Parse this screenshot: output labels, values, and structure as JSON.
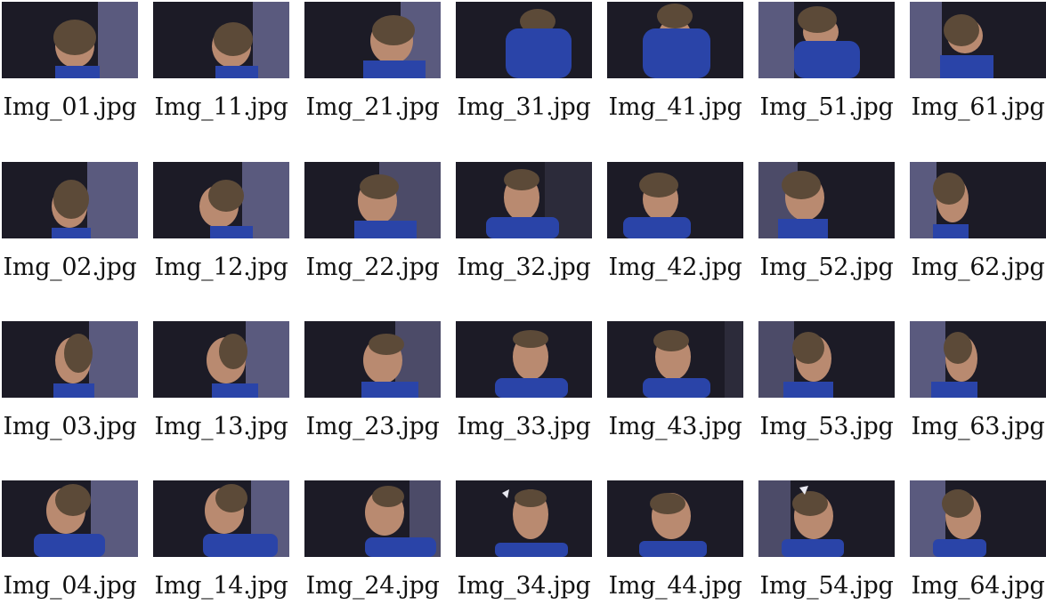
{
  "gallery": {
    "columns": 7,
    "rows": 4,
    "items": [
      {
        "filename": "Img_01.jpg"
      },
      {
        "filename": "Img_11.jpg"
      },
      {
        "filename": "Img_21.jpg"
      },
      {
        "filename": "Img_31.jpg"
      },
      {
        "filename": "Img_41.jpg"
      },
      {
        "filename": "Img_51.jpg"
      },
      {
        "filename": "Img_61.jpg"
      },
      {
        "filename": "Img_02.jpg"
      },
      {
        "filename": "Img_12.jpg"
      },
      {
        "filename": "Img_22.jpg"
      },
      {
        "filename": "Img_32.jpg"
      },
      {
        "filename": "Img_42.jpg"
      },
      {
        "filename": "Img_52.jpg"
      },
      {
        "filename": "Img_62.jpg"
      },
      {
        "filename": "Img_03.jpg"
      },
      {
        "filename": "Img_13.jpg"
      },
      {
        "filename": "Img_23.jpg"
      },
      {
        "filename": "Img_33.jpg"
      },
      {
        "filename": "Img_43.jpg"
      },
      {
        "filename": "Img_53.jpg"
      },
      {
        "filename": "Img_63.jpg"
      },
      {
        "filename": "Img_04.jpg"
      },
      {
        "filename": "Img_14.jpg"
      },
      {
        "filename": "Img_24.jpg"
      },
      {
        "filename": "Img_34.jpg"
      },
      {
        "filename": "Img_44.jpg"
      },
      {
        "filename": "Img_54.jpg"
      },
      {
        "filename": "Img_64.jpg"
      }
    ]
  },
  "colors": {
    "background": "#ffffff",
    "backdrop_dark": "#1c1b26",
    "curtain": "#5a5a7e",
    "shirt": "#2a44a8",
    "skin": "#b98a70",
    "hair": "#5c4a38"
  }
}
